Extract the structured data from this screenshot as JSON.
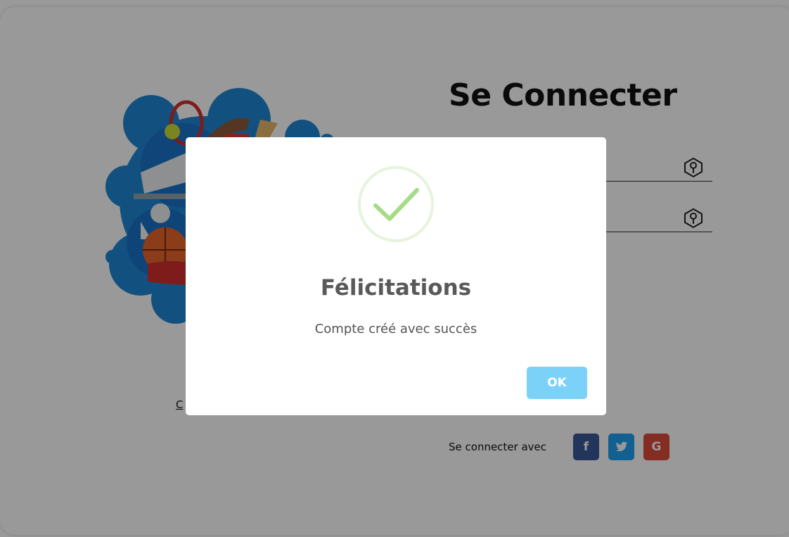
{
  "login": {
    "title": "Se Connecter",
    "create_account_link": "C",
    "social_label": "Se connecter avec",
    "social": [
      {
        "name": "facebook",
        "glyph": "f",
        "color": "#3b5998"
      },
      {
        "name": "twitter",
        "glyph": "🐦",
        "color": "#1da1f2"
      },
      {
        "name": "google",
        "glyph": "G",
        "color": "#dd4b39"
      }
    ]
  },
  "modal": {
    "icon": "success-check-icon",
    "title": "Félicitations",
    "text": "Compte créé avec succès",
    "ok_label": "OK",
    "ok_color": "#7cd1f9",
    "check_color": "#a5dc86"
  },
  "overlay_color": "rgba(0,0,0,0.40)"
}
